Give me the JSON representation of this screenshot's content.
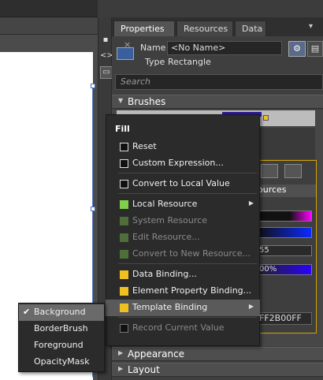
{
  "properties_panel": {
    "tabs": [
      {
        "label": "Properties",
        "close": "×"
      },
      {
        "label": "Resources"
      },
      {
        "label": "Data"
      }
    ],
    "name_label": "Name",
    "name_value": "<No Name>",
    "type_label": "Type",
    "type_value": "Rectangle",
    "search_placeholder": "Search",
    "sections": {
      "brushes": "Brushes",
      "appearance": "Appearance",
      "layout": "Layout"
    },
    "editor_partial": {
      "resources_text": "ources",
      "value_55": "55",
      "value_percent": "00%",
      "hex_text": "FF2B00FF"
    },
    "swatch_color": "#3b5f9e"
  },
  "context_menu": {
    "title": "Fill",
    "items": [
      {
        "label": "Reset",
        "enabled": true,
        "icon": "checkbox"
      },
      {
        "label": "Custom Expression...",
        "enabled": true,
        "icon": "checkbox"
      },
      {
        "label": "Convert to Local Value",
        "enabled": true,
        "icon": "checkbox"
      },
      {
        "label": "Local Resource",
        "enabled": true,
        "icon": "green-square",
        "submenu": true
      },
      {
        "label": "System Resource",
        "enabled": false,
        "icon": "green-square"
      },
      {
        "label": "Edit Resource...",
        "enabled": false,
        "icon": "green-square"
      },
      {
        "label": "Convert to New Resource...",
        "enabled": false,
        "icon": "green-square"
      },
      {
        "label": "Data Binding...",
        "enabled": true,
        "icon": "yellow-square"
      },
      {
        "label": "Element Property Binding...",
        "enabled": true,
        "icon": "yellow-square"
      },
      {
        "label": "Template Binding",
        "enabled": true,
        "icon": "yellow-square",
        "submenu": true,
        "highlighted": true
      },
      {
        "label": "Record Current Value",
        "enabled": false,
        "icon": "checkbox"
      }
    ],
    "colors": {
      "green": "#7fcf4a",
      "yellow": "#f0c020",
      "disabled_green": "#4f6f3a"
    }
  },
  "template_binding_submenu": {
    "items": [
      {
        "label": "Background",
        "checked": true
      },
      {
        "label": "BorderBrush",
        "checked": false
      },
      {
        "label": "Foreground",
        "checked": false
      },
      {
        "label": "OpacityMask",
        "checked": false
      }
    ],
    "check_glyph": "✔"
  }
}
